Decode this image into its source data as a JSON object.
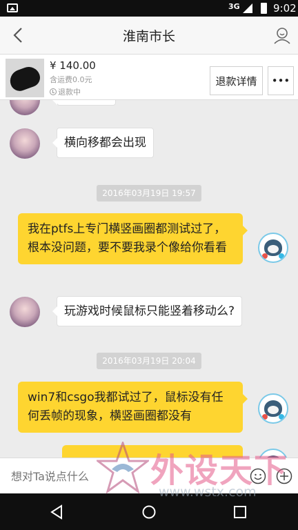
{
  "status_bar": {
    "network": "3G",
    "time": "9:02",
    "icons": [
      "gallery-icon",
      "signal-icon",
      "battery-icon"
    ]
  },
  "header": {
    "title": "淮南市长",
    "back_icon": "back-arrow-icon",
    "profile_icon": "user-profile-icon"
  },
  "product": {
    "price": "¥ 140.00",
    "shipping": "含运费0.0元",
    "status": "退款中",
    "refund_button": "退款详情",
    "more_button": "•••"
  },
  "messages": [
    {
      "side": "left",
      "text": "横向移都会出现"
    },
    {
      "type": "timestamp",
      "text": "2016年03月19日 19:57"
    },
    {
      "side": "right",
      "text": "我在ptfs上专门横竖画圈都测试过了，根本没问题，要不要我录个像给你看看"
    },
    {
      "side": "left",
      "text": "玩游戏时候鼠标只能竖着移动么?"
    },
    {
      "type": "timestamp",
      "text": "2016年03月19日 20:04"
    },
    {
      "side": "right",
      "text": "win7和csgo我都试过了，鼠标没有任何丢帧的现象，横竖画圈都没有"
    }
  ],
  "input": {
    "placeholder": "想对Ta说点什么",
    "emoji_icon": "emoji-icon",
    "plus_icon": "plus-icon"
  },
  "watermark": {
    "brand": "外设天下",
    "url": "www.wstx.com"
  },
  "colors": {
    "my_bubble": "#fed530",
    "their_bubble": "#ffffff",
    "background": "#ececec"
  }
}
